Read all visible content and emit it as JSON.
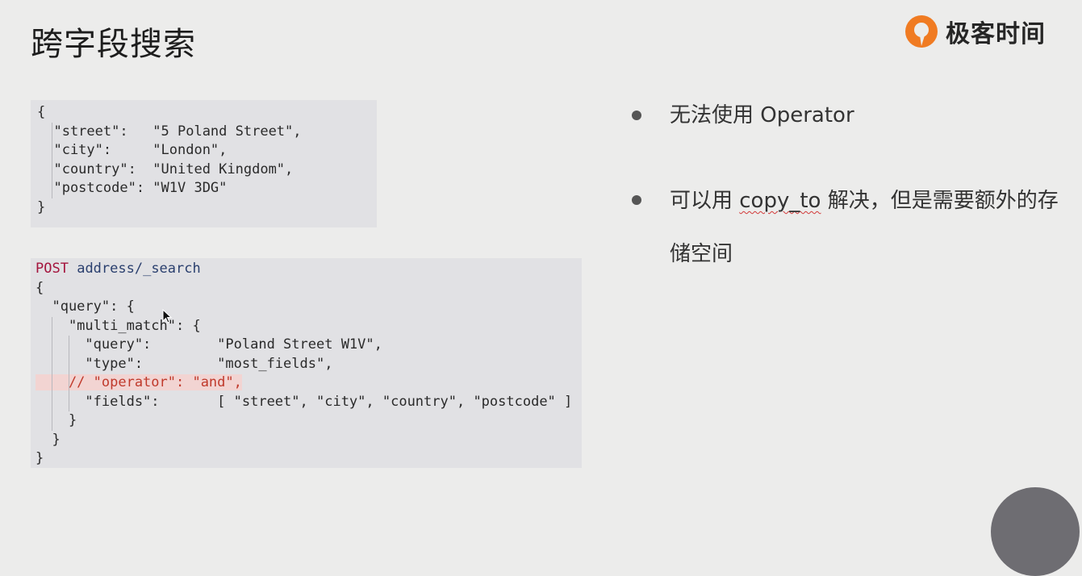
{
  "slide": {
    "title": "跨字段搜索",
    "logo_text": "极客时间"
  },
  "code1": {
    "lines": [
      "{",
      "  \"street\":   \"5 Poland Street\",",
      "  \"city\":     \"London\",",
      "  \"country\":  \"United Kingdom\",",
      "  \"postcode\": \"W1V 3DG\"",
      "}"
    ]
  },
  "code2": {
    "method": "POST",
    "path": "address/_search",
    "lines": [
      "{",
      "  \"query\": {",
      "    \"multi_match\": {",
      "      \"query\":        \"Poland Street W1V\",",
      "      \"type\":         \"most_fields\",",
      "    // \"operator\": \"and\",",
      "      \"fields\":       [ \"street\", \"city\", \"country\", \"postcode\" ]",
      "    }",
      "  }",
      "}"
    ]
  },
  "bullets": {
    "item1": "无法使用 Operator",
    "item2_pre": "可以用 ",
    "item2_code": "copy_to",
    "item2_post": " 解决，但是需要额外的存储空间"
  },
  "colors": {
    "background": "#ececeb",
    "code_bg": "#e1e1e4",
    "string": "#2e7d32",
    "keyword": "#a4143d",
    "comment": "#c0392b",
    "logo_accent": "#f07b22"
  },
  "icons": {
    "logo": "geektime-logo-icon",
    "cursor": "move-cursor-icon"
  }
}
